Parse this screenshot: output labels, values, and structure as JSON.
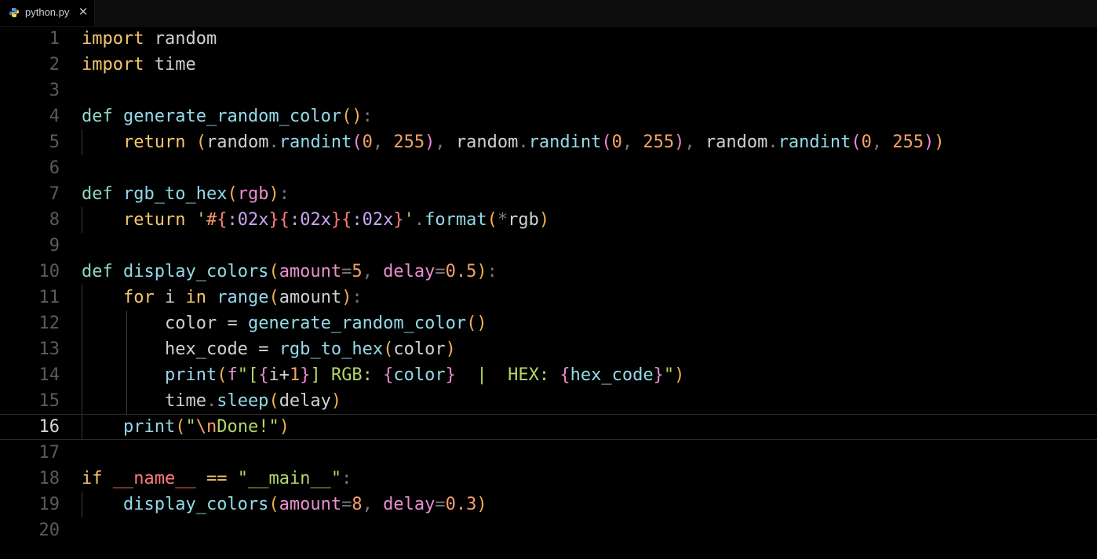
{
  "tab": {
    "filename": "python.py",
    "close_glyph": "✕",
    "icon": "python-icon"
  },
  "editor": {
    "active_line": 16,
    "line_numbers": [
      "1",
      "2",
      "3",
      "4",
      "5",
      "6",
      "7",
      "8",
      "9",
      "10",
      "11",
      "12",
      "13",
      "14",
      "15",
      "16",
      "17",
      "18",
      "19",
      "20"
    ],
    "lines": [
      "import random",
      "import time",
      "",
      "def generate_random_color():",
      "    return (random.randint(0, 255), random.randint(0, 255), random.randint(0, 255))",
      "",
      "def rgb_to_hex(rgb):",
      "    return '#{:02x}{:02x}{:02x}'.format(*rgb)",
      "",
      "def display_colors(amount=5, delay=0.5):",
      "    for i in range(amount):",
      "        color = generate_random_color()",
      "        hex_code = rgb_to_hex(color)",
      "        print(f\"[{i+1}] RGB: {color}  |  HEX: {hex_code}\")",
      "        time.sleep(delay)",
      "    print(\"\\nDone!\")",
      "",
      "if __name__ == \"__main__\":",
      "    display_colors(amount=8, delay=0.3)",
      ""
    ]
  },
  "colors": {
    "background": "#000000",
    "keyword": "#f6c76b",
    "function": "#92dbe9",
    "string": "#b4d66a",
    "number": "#f5a06a",
    "parameter": "#ea8fcf",
    "line_number": "#5b5b5b",
    "line_number_active": "#d4d4d4"
  }
}
